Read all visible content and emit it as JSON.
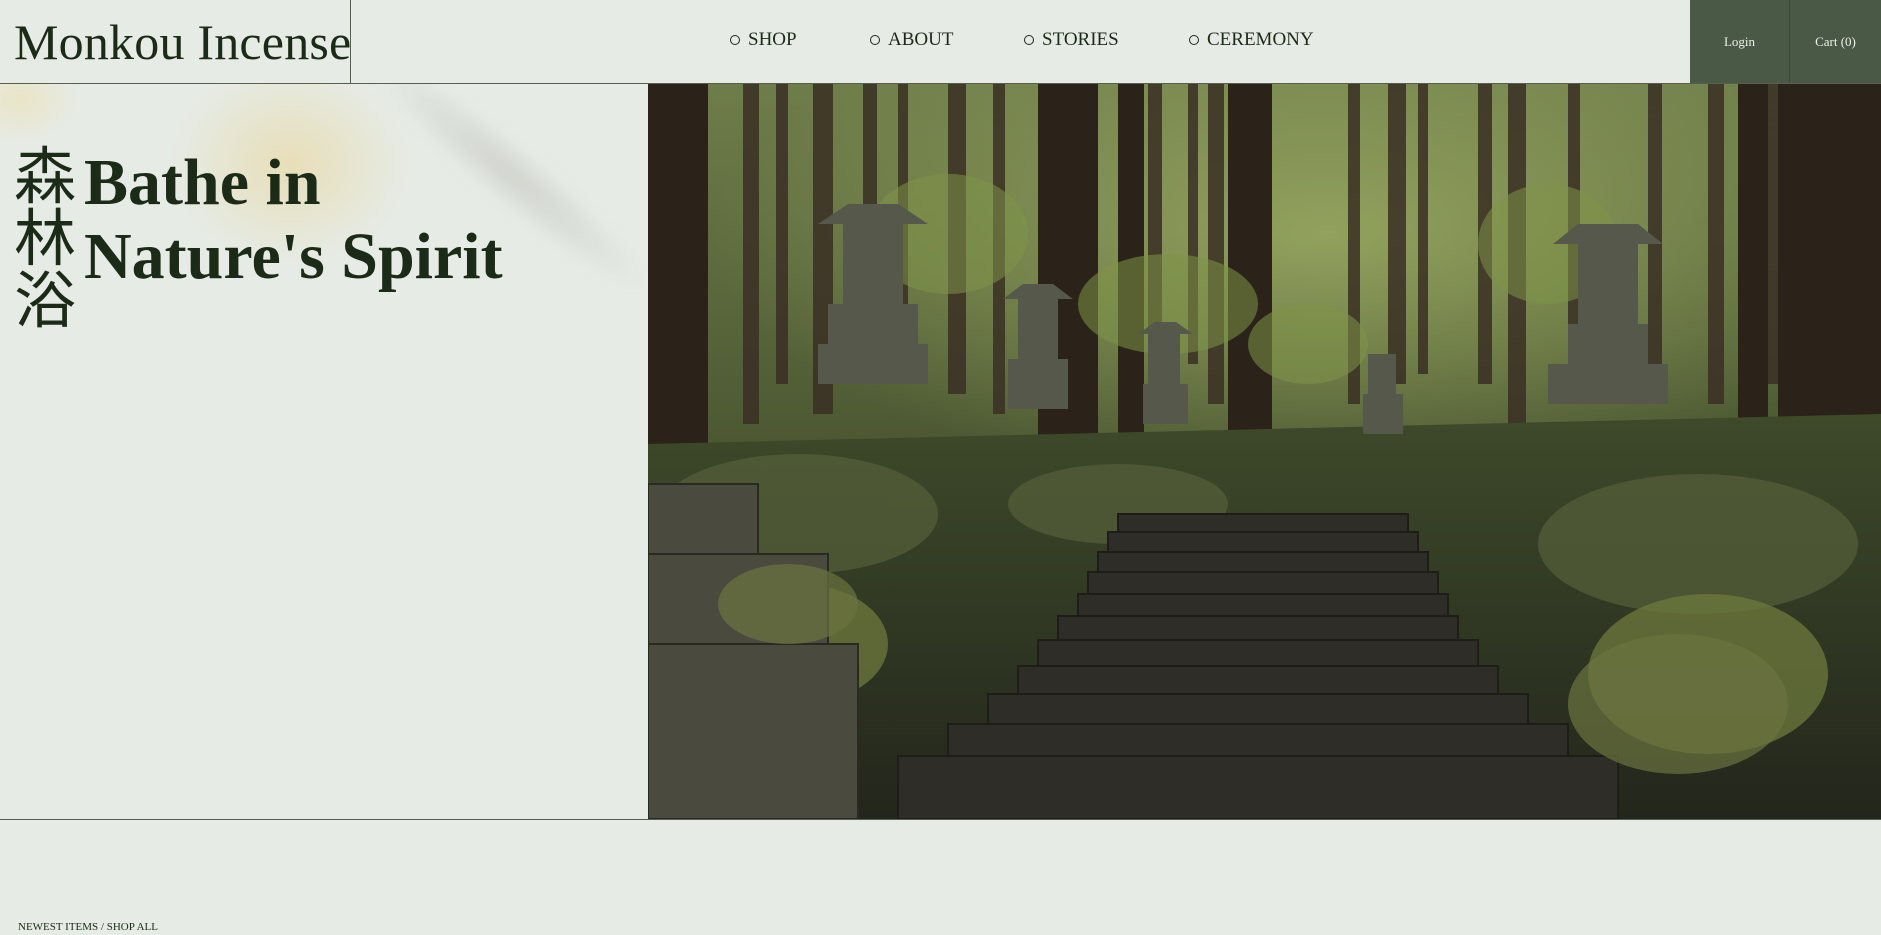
{
  "header": {
    "logo": "Monkou Incense",
    "nav": [
      {
        "label": "SHOP"
      },
      {
        "label": "ABOUT"
      },
      {
        "label": "STORIES"
      },
      {
        "label": "CEREMONY"
      }
    ],
    "login_label": "Login",
    "cart_label": "Cart (0)"
  },
  "hero": {
    "kanji": [
      "森",
      "林",
      "浴"
    ],
    "title_lines": [
      "Bathe in",
      "Nature's Spirit"
    ],
    "image_subject": "forest-path-stone-lanterns"
  },
  "section": {
    "label": "NEWEST ITEMS / SHOP ALL"
  },
  "colors": {
    "background": "#e6ebe5",
    "text": "#1c2a18",
    "accent_button": "#4a5946",
    "button_text": "#eef1ec",
    "border": "#55604f"
  }
}
